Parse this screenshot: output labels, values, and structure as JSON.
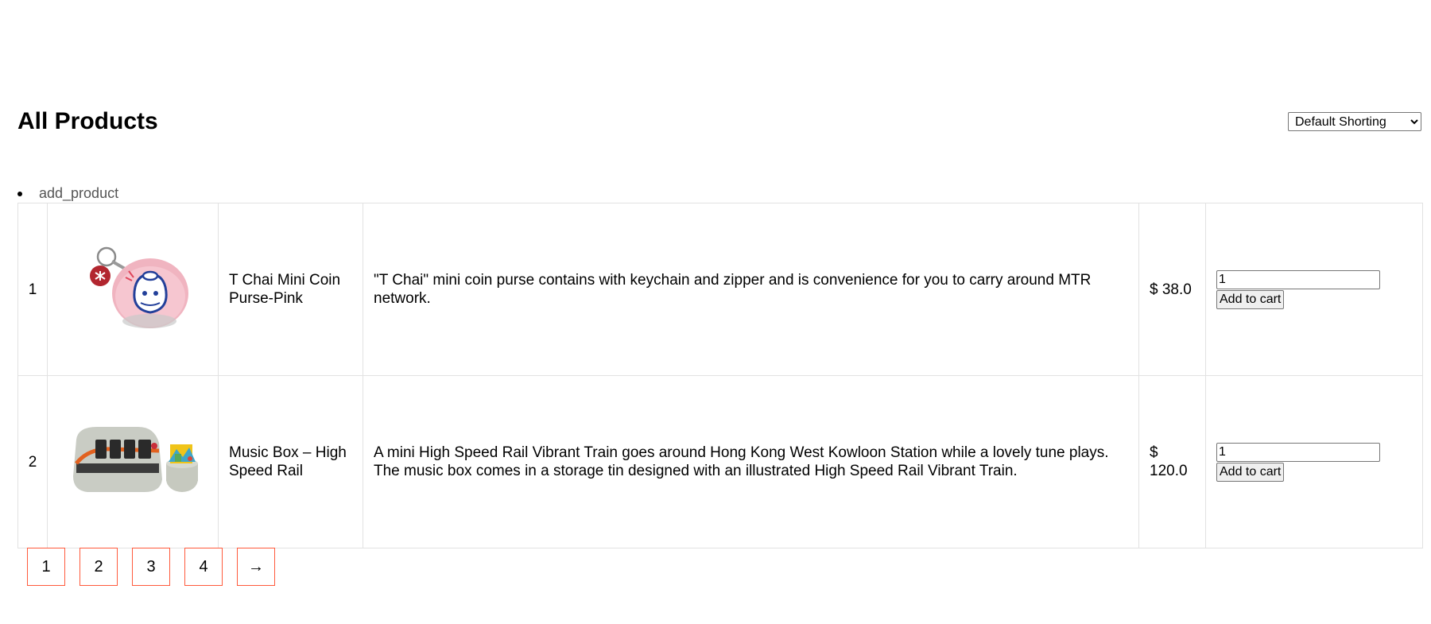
{
  "header": {
    "title": "All Products",
    "sort_selected": "Default Shorting"
  },
  "admin_links": [
    {
      "label": "add_product"
    }
  ],
  "products": [
    {
      "index": "1",
      "image_icon": "coin-purse-keychain-icon",
      "name": "T Chai Mini Coin Purse-Pink",
      "description": "\"T Chai\" mini coin purse contains with keychain and zipper and is convenience for you to carry around MTR network.",
      "price": "$ 38.0",
      "quantity": "1",
      "add_to_cart_label": "Add to cart"
    },
    {
      "index": "2",
      "image_icon": "music-box-train-icon",
      "name": "Music Box – High Speed Rail",
      "description": "A mini High Speed Rail Vibrant Train goes around Hong Kong West Kowloon Station while a lovely tune plays. The music box comes in a storage tin designed with an illustrated High Speed Rail Vibrant Train.",
      "price": "$ 120.0",
      "quantity": "1",
      "add_to_cart_label": "Add to cart"
    }
  ],
  "pagination": {
    "pages": [
      "1",
      "2",
      "3",
      "4"
    ],
    "next": "→"
  },
  "colors": {
    "pagination_border": "#ff5a3c",
    "table_border": "#e2e2e2",
    "link_text": "#555555"
  }
}
